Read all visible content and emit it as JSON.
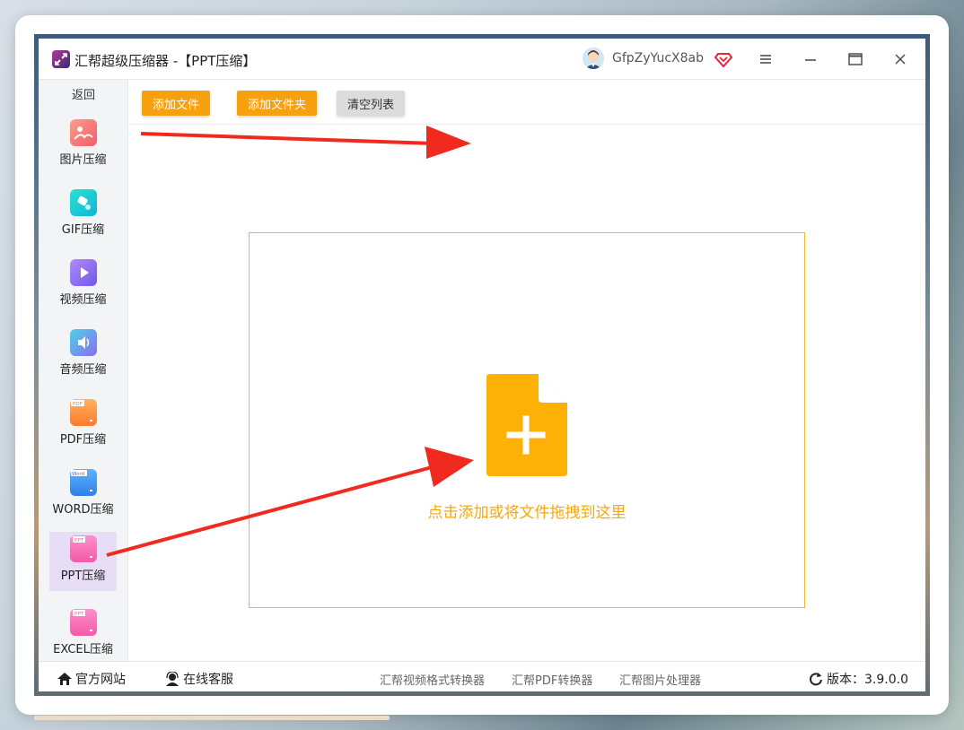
{
  "app": {
    "title": "汇帮超级压缩器  -【PPT压缩】",
    "username": "GfpZyYucX8ab"
  },
  "sidebar": {
    "back_label": "返回",
    "items": [
      {
        "label": "图片压缩",
        "icon": "image-icon",
        "color": "#f5706c"
      },
      {
        "label": "GIF压缩",
        "icon": "gif-icon",
        "color": "#12c8d6"
      },
      {
        "label": "视频压缩",
        "icon": "video-icon",
        "color": "#8a63ee"
      },
      {
        "label": "音频压缩",
        "icon": "audio-icon",
        "color": "#7b74f0"
      },
      {
        "label": "PDF压缩",
        "icon": "pdf-icon",
        "color": "#fb8a3a"
      },
      {
        "label": "WORD压缩",
        "icon": "word-icon",
        "color": "#3b8cf0"
      },
      {
        "label": "PPT压缩",
        "icon": "ppt-icon",
        "color": "#f763b4"
      },
      {
        "label": "EXCEL压缩",
        "icon": "excel-icon",
        "color": "#f763b4"
      }
    ],
    "active_index": 6
  },
  "toolbar": {
    "add_file": "添加文件",
    "add_folder": "添加文件夹",
    "clear_list": "清空列表"
  },
  "dropzone": {
    "text": "点击添加或将文件拖拽到这里",
    "accent": "#f4a80e"
  },
  "statusbar": {
    "website": "官方网站",
    "support": "在线客服",
    "links": [
      "汇帮视频格式转换器",
      "汇帮PDF转换器",
      "汇帮图片处理器"
    ],
    "version": "版本：3.9.0.0"
  },
  "colors": {
    "orange": "#f7a10f",
    "arrow_red": "#f02a1e",
    "active_bg": "#e8ddf6"
  }
}
